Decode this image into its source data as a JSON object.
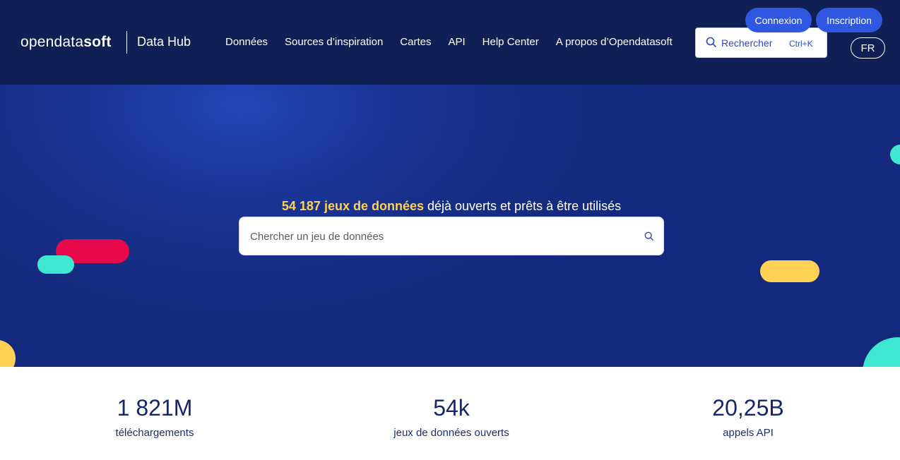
{
  "header": {
    "logo_light": "open",
    "logo_mid": "data",
    "logo_bold": "soft",
    "hub_title": "Data Hub",
    "nav": [
      {
        "label": "Données"
      },
      {
        "label": "Sources d’inspiration"
      },
      {
        "label": "Cartes"
      },
      {
        "label": "API"
      },
      {
        "label": "Help Center"
      },
      {
        "label": "A propos d’Opendatasoft"
      }
    ],
    "search_label": "Rechercher",
    "search_shortcut": "Ctrl+K",
    "login_label": "Connexion",
    "signup_label": "Inscription",
    "lang_label": "FR"
  },
  "hero": {
    "count": "54 187",
    "highlight": "jeux de données",
    "rest": " déjà ouverts et prêts à être utilisés",
    "search_placeholder": "Chercher un jeu de données"
  },
  "stats": [
    {
      "value": "1 821M",
      "label": "téléchargements"
    },
    {
      "value": "54k",
      "label": "jeux de données ouverts"
    },
    {
      "value": "20,25B",
      "label": "appels API"
    }
  ],
  "colors": {
    "header_bg": "#101f54",
    "accent_blue": "#2f57e0",
    "highlight_yellow": "#ffd256",
    "shape_red": "#e8094c",
    "shape_teal": "#3ee8d0",
    "shape_yellow": "#ffd256"
  }
}
